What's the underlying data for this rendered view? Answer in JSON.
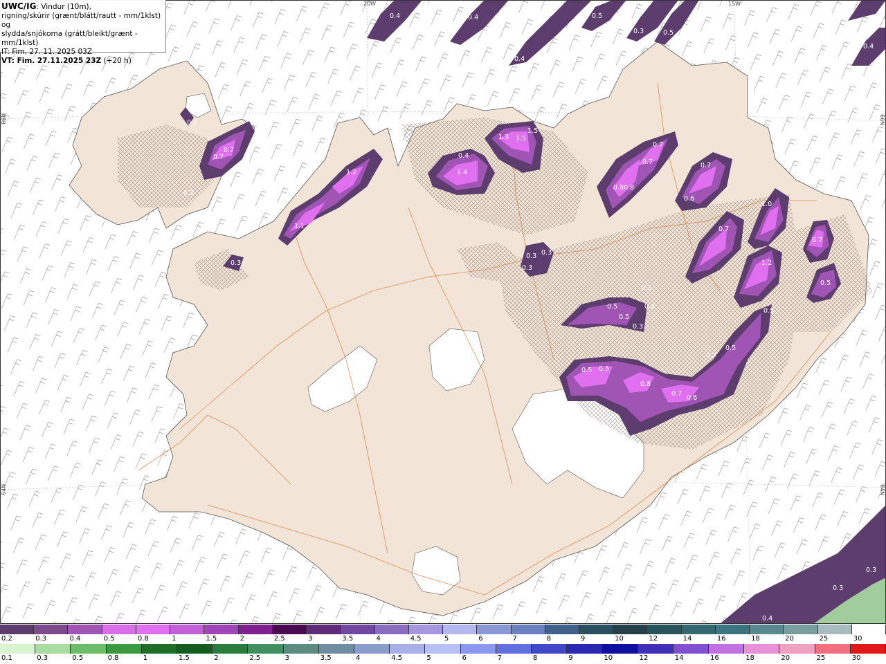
{
  "header": {
    "title": "UWC/IG",
    "line1": ": Vindur (10m),",
    "line2": "rigning/skúrir (grænt/blátt/rautt - mm/1klst) og",
    "line3": "slydda/snjókoma (grátt/bleikt/grænt - mm/1klst)",
    "it": "IT: Fim. 27. 11. 2025 03Z",
    "vt": "VT: Fim. 27.11.2025 23Z",
    "vt_suffix": " (+20 h)"
  },
  "graticule": {
    "lon_labels": [
      "20W",
      "15W"
    ],
    "lat_labels_left": [
      "66N",
      "64N"
    ],
    "lat_labels_right": [
      "66N",
      "64N"
    ]
  },
  "precip_values": [
    "0.4",
    "0.4",
    "0.4",
    "0.5",
    "0.3",
    "0.5",
    "0.4",
    "0.4",
    "0.2",
    "0.7",
    "0.7",
    "0.3",
    "1.2",
    "1.1",
    "0.3",
    "0.4",
    "1.4",
    "1.3",
    "1.5",
    "1.5",
    "0.7",
    "0.7",
    "0.7",
    "0.80.8",
    "0.6",
    "1.0",
    "0.7",
    "0.7",
    "0.3",
    "0.3",
    "0.3",
    "1.2",
    "0.3",
    "0.5",
    "0.5",
    "0.2",
    "0.3",
    "0.5",
    "0.5",
    "0.5",
    "0.7",
    "0.5",
    "0.5",
    "0.8",
    "0.7",
    "0.6",
    "0.3",
    "0.3",
    "0.4"
  ],
  "legend_snow": {
    "labels": [
      "0.2",
      "0.3",
      "0.4",
      "0.5",
      "0.8",
      "1",
      "1.5",
      "2",
      "2.5",
      "3",
      "3.5",
      "4",
      "4.5",
      "5",
      "6",
      "7",
      "8",
      "9",
      "10",
      "12",
      "14",
      "16",
      "18",
      "20",
      "25",
      "30"
    ],
    "colors": [
      "#5c3d6e",
      "#7d4a8e",
      "#a055b5",
      "#d86ee8",
      "#e070f0",
      "#c35fd9",
      "#a045b8",
      "#80208f",
      "#4a0a52",
      "#5f2a78",
      "#7048a0",
      "#8a6dc0",
      "#a598e0",
      "#b3b8f0",
      "#8a98d8",
      "#6a80c0",
      "#40608a",
      "#2a5060",
      "#244048",
      "#28545c",
      "#326870",
      "#3c7480",
      "#56888e",
      "#7a9ea0",
      "#a8bcc0",
      "#ffffff"
    ]
  },
  "legend_rain": {
    "labels": [
      "0.1",
      "0.3",
      "0.5",
      "0.8",
      "1",
      "1.5",
      "2",
      "2.5",
      "3",
      "3.5",
      "4",
      "4.5",
      "5",
      "6",
      "7",
      "8",
      "9",
      "10",
      "12",
      "14",
      "16",
      "18",
      "20",
      "25",
      "30"
    ],
    "colors": [
      "#d8f5d0",
      "#a8dca0",
      "#6cbc6a",
      "#3a9a40",
      "#1e6e28",
      "#145c20",
      "#2a7c3c",
      "#408f60",
      "#5c8c80",
      "#708ca0",
      "#8a9ccc",
      "#a8b0e8",
      "#b8c0f8",
      "#8a98f0",
      "#6070e0",
      "#4048c8",
      "#2828b0",
      "#1010a0",
      "#4030b8",
      "#8050d0",
      "#c070e0",
      "#e890d8",
      "#f0a0c0",
      "#f07080",
      "#e01818"
    ]
  }
}
